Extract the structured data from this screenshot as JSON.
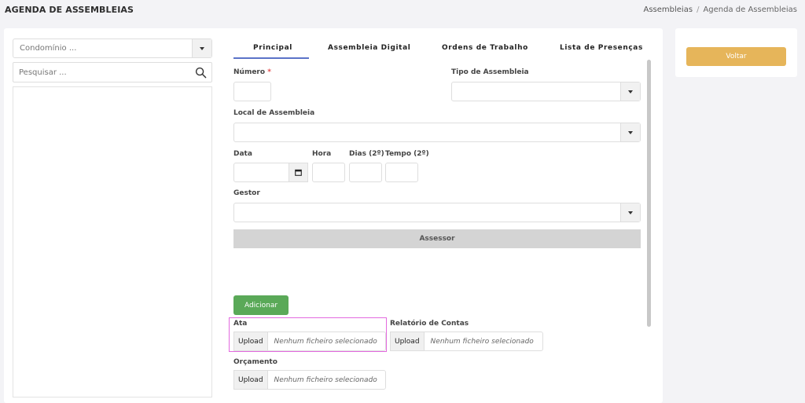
{
  "page": {
    "title": "AGENDA DE ASSEMBLEIAS",
    "breadcrumb": {
      "parent": "Assembleias",
      "separator": "/",
      "current": "Agenda de Assembleias"
    }
  },
  "sidebar_left": {
    "condominio_select": {
      "placeholder": "Condomínio ..."
    },
    "search": {
      "placeholder": "Pesquisar ..."
    }
  },
  "tabs": [
    {
      "label": "Principal",
      "active": true
    },
    {
      "label": "Assembleia Digital"
    },
    {
      "label": "Ordens de Trabalho"
    },
    {
      "label": "Lista de Presenças"
    }
  ],
  "form": {
    "numero_label": "Número",
    "required_mark": "*",
    "tipo_label": "Tipo de Assembleia",
    "local_label": "Local de Assembleia",
    "data_label": "Data",
    "hora_label": "Hora",
    "dias_label": "Dias (2º)",
    "tempo_label": "Tempo (2º)",
    "gestor_label": "Gestor",
    "assessor_label": "Assessor",
    "add_label": "Adicionar",
    "ata_label": "Ata",
    "relatorio_label": "Relatório de Contas",
    "orcamento_label": "Orçamento",
    "upload_label": "Upload",
    "no_file": "Nenhum ficheiro selecionado"
  },
  "side_panel": {
    "voltar_label": "Voltar"
  },
  "colors": {
    "accent_tab": "#5b73c8",
    "voltar": "#e6b55a",
    "add": "#5aa958",
    "highlight": "#e36adf"
  }
}
